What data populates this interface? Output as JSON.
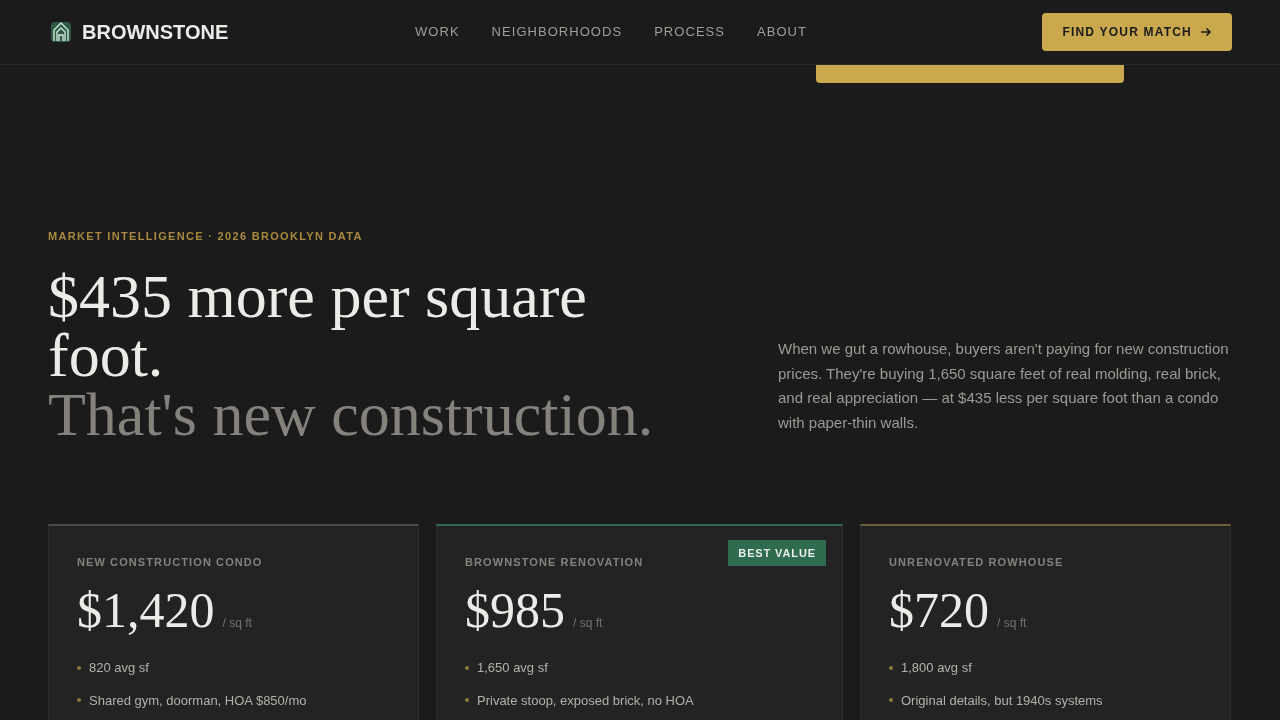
{
  "brand": "BROWNSTONE",
  "nav": [
    {
      "label": "WORK"
    },
    {
      "label": "NEIGHBORHOODS"
    },
    {
      "label": "PROCESS"
    },
    {
      "label": "ABOUT"
    }
  ],
  "cta": "FIND YOUR MATCH",
  "eyebrow": "MARKET INTELLIGENCE · 2026 BROOKLYN DATA",
  "headline": "$435 more per square foot.",
  "headline_muted": "That's new construction.",
  "intro": "When we gut a rowhouse, buyers aren't paying for new construction prices. They're buying 1,650 square feet of real molding, real brick, and real appreciation — at $435 less per square foot than a condo with paper-thin walls.",
  "cards": [
    {
      "title": "NEW CONSTRUCTION CONDO",
      "price": "$1,420",
      "unit": "/ sq ft",
      "color": "#4a4a4a",
      "features": [
        "820 avg sf",
        "Shared gym, doorman, HOA $850/mo"
      ]
    },
    {
      "title": "BROWNSTONE RENOVATION",
      "price": "$985",
      "unit": "/ sq ft",
      "color": "#2f6b4f",
      "badge": "BEST VALUE",
      "features": [
        "1,650 avg sf",
        "Private stoop, exposed brick, no HOA"
      ]
    },
    {
      "title": "UNRENOVATED ROWHOUSE",
      "price": "$720",
      "unit": "/ sq ft",
      "color": "#6b5f3a",
      "features": [
        "1,800 avg sf",
        "Original details, but 1940s systems"
      ]
    }
  ]
}
